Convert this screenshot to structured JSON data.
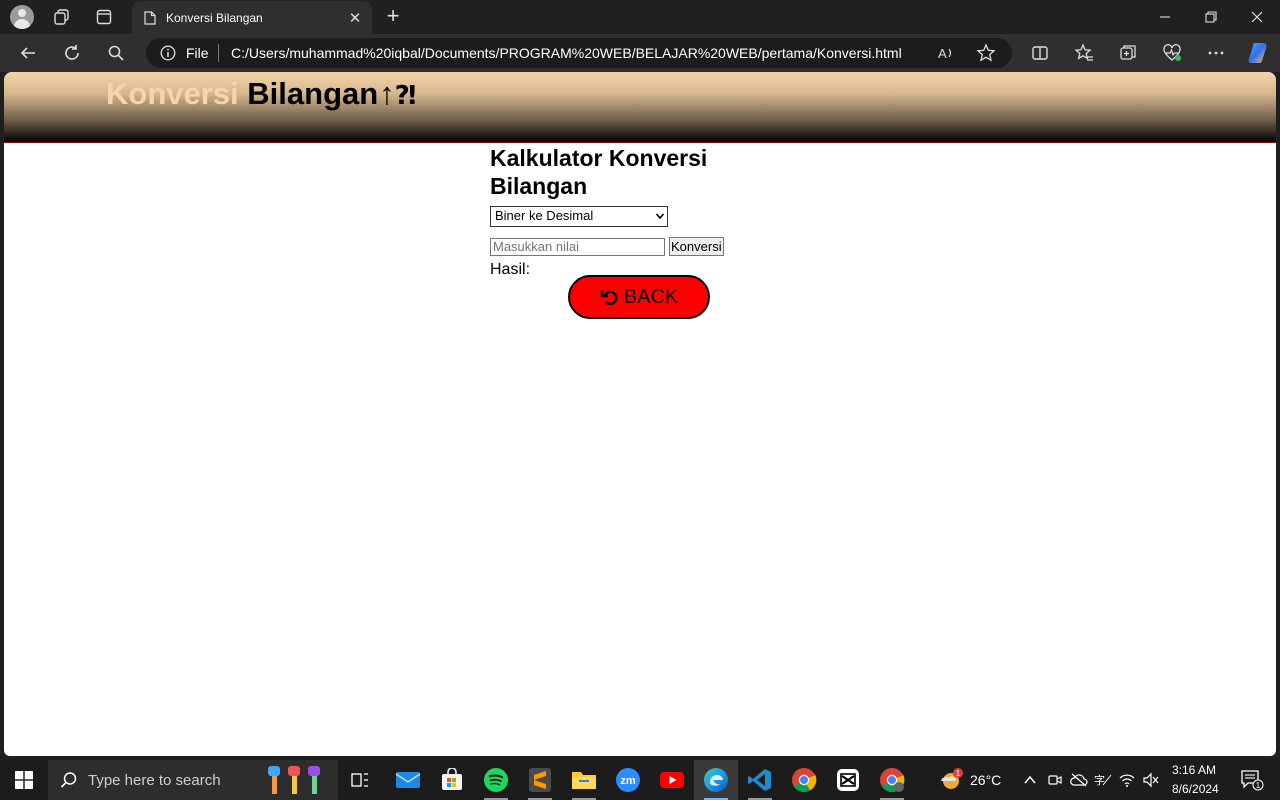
{
  "browser": {
    "tab_title": "Konversi Bilangan",
    "file_label": "File",
    "url": "C:/Users/muhammad%20iqbal/Documents/PROGRAM%20WEB/BELAJAR%20WEB/pertama/Konversi.html"
  },
  "page": {
    "title_word1": "Konversi",
    "title_word2": "Bilangan",
    "title_icon": "↑",
    "title_icon2": "⁈",
    "calc_title": "Kalkulator Konversi Bilangan",
    "select_value": "Biner ke Desimal",
    "input_placeholder": "Masukkan nilai",
    "convert_label": "Konversi",
    "result_label": "Hasil:",
    "back_label": "BACK"
  },
  "taskbar": {
    "search_placeholder": "Type here to search",
    "weather_temp": "26°C",
    "weather_badge": "1",
    "time": "3:16 AM",
    "date": "8/6/2024",
    "notification_count": "1"
  }
}
